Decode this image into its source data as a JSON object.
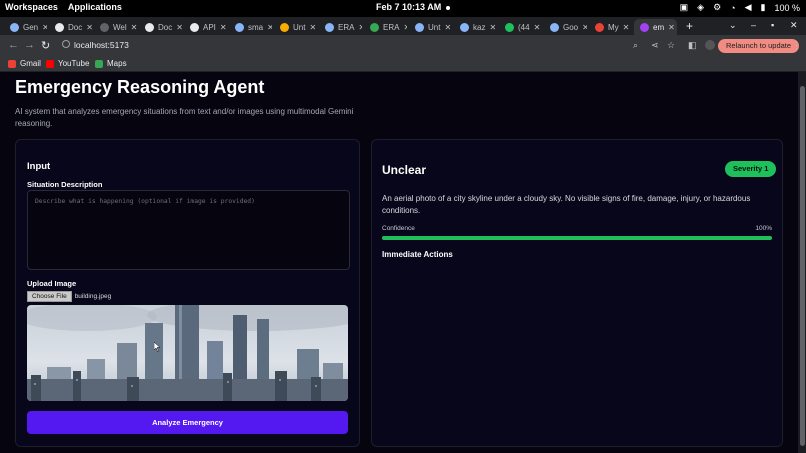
{
  "system_bar": {
    "workspaces": "Workspaces",
    "applications": "Applications",
    "clock": "Feb 7  10:13 AM",
    "battery": "100 %"
  },
  "tabs": [
    {
      "label": "Gen",
      "color": "#8ab4f8"
    },
    {
      "label": "Doc",
      "color": "#e8eaed"
    },
    {
      "label": "Wel",
      "color": "#5f6368"
    },
    {
      "label": "Doc",
      "color": "#e8eaed"
    },
    {
      "label": "API",
      "color": "#e8eaed"
    },
    {
      "label": "sma",
      "color": "#8ab4f8"
    },
    {
      "label": "Unt",
      "color": "#f9ab00"
    },
    {
      "label": "ERA",
      "color": "#8ab4f8"
    },
    {
      "label": "ERA",
      "color": "#34a853"
    },
    {
      "label": "Unt",
      "color": "#8ab4f8"
    },
    {
      "label": "kaz",
      "color": "#8ab4f8"
    },
    {
      "label": "(44",
      "color": "#1fc05c"
    },
    {
      "label": "Goo",
      "color": "#8ab4f8"
    },
    {
      "label": "My",
      "color": "#ea4335"
    },
    {
      "label": "em",
      "color": "#a142f4",
      "active": true
    }
  ],
  "browser": {
    "url": "localhost:5173",
    "relaunch_label": "Relaunch to update"
  },
  "bookmarks": [
    {
      "label": "Gmail",
      "color": "#ea4335"
    },
    {
      "label": "YouTube",
      "color": "#ff0000"
    },
    {
      "label": "Maps",
      "color": "#34a853"
    }
  ],
  "header": {
    "title": "Emergency Reasoning Agent",
    "description": "AI system that analyzes emergency situations from text and/or images using multimodal Gemini reasoning."
  },
  "input_panel": {
    "title": "Input",
    "situation_label": "Situation Description",
    "situation_placeholder": "Describe what is happening (optional if image is provided)",
    "situation_value": "",
    "upload_label": "Upload Image",
    "choose_file_label": "Choose File",
    "file_name": "building.jpeg",
    "analyze_label": "Analyze Emergency"
  },
  "result_panel": {
    "classification": "Unclear",
    "severity_label": "Severity 1",
    "summary": "An aerial photo of a city skyline under a cloudy sky. No visible signs of fire, damage, injury, or hazardous conditions.",
    "confidence_label": "Confidence",
    "confidence_value": "100%",
    "confidence_fraction": 1.0,
    "actions_title": "Immediate Actions"
  },
  "colors": {
    "accent": "#5419f1",
    "severity_green": "#1fc05c",
    "background": "#05040f"
  }
}
